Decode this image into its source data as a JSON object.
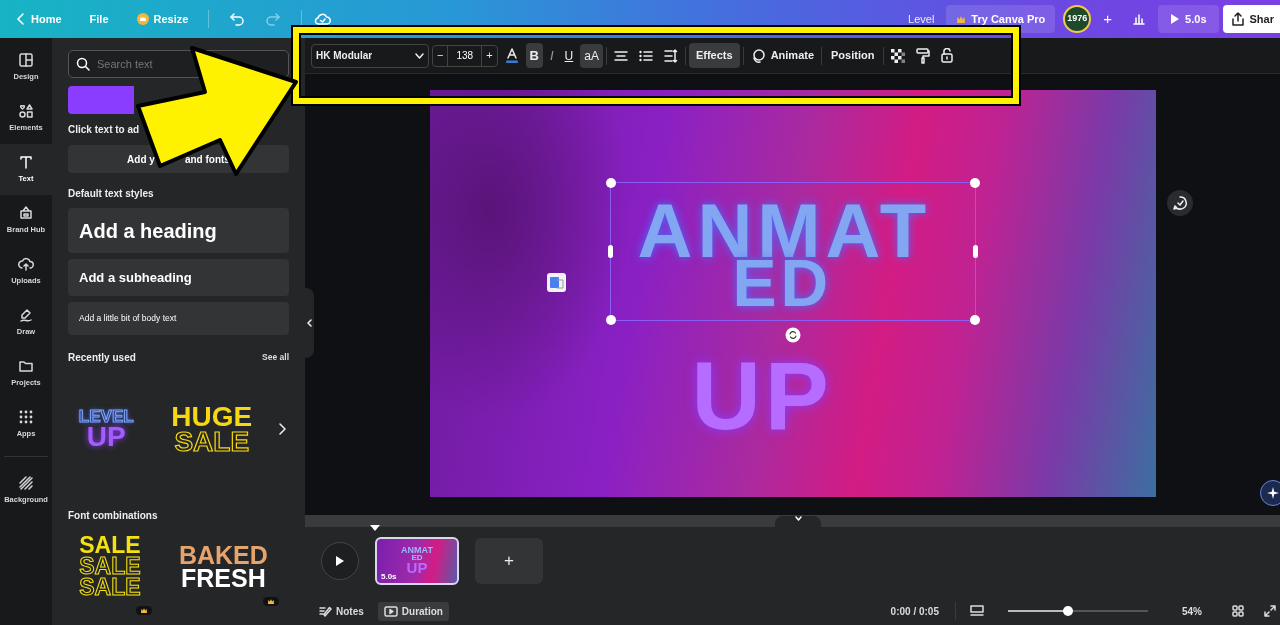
{
  "topbar": {
    "home": "Home",
    "file": "File",
    "resize": "Resize",
    "level": "Level",
    "pro": "Try Canva Pro",
    "avatar": "1976",
    "add": "+",
    "play_time": "5.0s",
    "share": "Shar"
  },
  "rail": [
    {
      "label": "Design",
      "kind": "layout",
      "selected": false
    },
    {
      "label": "Elements",
      "kind": "shapes",
      "selected": false
    },
    {
      "label": "Text",
      "kind": "text",
      "selected": true
    },
    {
      "label": "Brand Hub",
      "kind": "brand",
      "selected": false
    },
    {
      "label": "Uploads",
      "kind": "upload",
      "selected": false
    },
    {
      "label": "Draw",
      "kind": "draw",
      "selected": false
    },
    {
      "label": "Projects",
      "kind": "folder",
      "selected": false
    },
    {
      "label": "Apps",
      "kind": "apps",
      "selected": false
    },
    {
      "label": "Background",
      "kind": "background",
      "selected": false
    }
  ],
  "panel": {
    "search_placeholder": "Search text",
    "hint": "Click text to ad",
    "brand_button": [
      "Add y",
      "and fonts"
    ],
    "styles_title": "Default text styles",
    "styles": [
      {
        "kind": "heading",
        "label": "Add a heading"
      },
      {
        "kind": "subheading",
        "label": "Add a subheading"
      },
      {
        "kind": "body",
        "label": "Add a little bit of body text"
      }
    ],
    "recent_title": "Recently used",
    "see_all": "See all",
    "recent": [
      {
        "kind": "neon",
        "lines": [
          "LEVEL",
          "UP"
        ]
      },
      {
        "kind": "sale",
        "lines": [
          "HUGE",
          "SALE"
        ]
      }
    ],
    "combos_title": "Font combinations",
    "combos": [
      {
        "kind": "stack",
        "lines": [
          "SALE",
          "SALE",
          "SALE"
        ],
        "premium": true
      },
      {
        "kind": "baked",
        "lines": [
          "BAKED",
          "FRESH"
        ],
        "premium": true
      }
    ]
  },
  "toolbar": {
    "font": "HK Modular",
    "minus": "−",
    "size": "138",
    "plus": "+",
    "format": [
      {
        "kind": "bold",
        "label": "B",
        "selected": true
      },
      {
        "kind": "italic",
        "label": "I",
        "selected": false
      },
      {
        "kind": "underline",
        "label": "U",
        "selected": false
      },
      {
        "kind": "case",
        "label": "aA",
        "selected": true
      }
    ],
    "effects": {
      "label": "Effects",
      "selected": true
    },
    "animate": "Animate",
    "position": "Position"
  },
  "design": {
    "lines": [
      "ANMAT",
      "ED",
      "UP"
    ]
  },
  "timeline": {
    "pages": [
      {
        "lines": [
          "ANMAT",
          "ED",
          "UP"
        ],
        "duration": "5.0s",
        "selected": true
      }
    ],
    "add": "+"
  },
  "footer": {
    "notes": {
      "label": "Notes",
      "selected": false
    },
    "duration": {
      "label": "Duration",
      "selected": true
    },
    "time": "0:00 / 0:05",
    "zoom": {
      "level": 0.43
    },
    "zoom_label": "54%"
  }
}
